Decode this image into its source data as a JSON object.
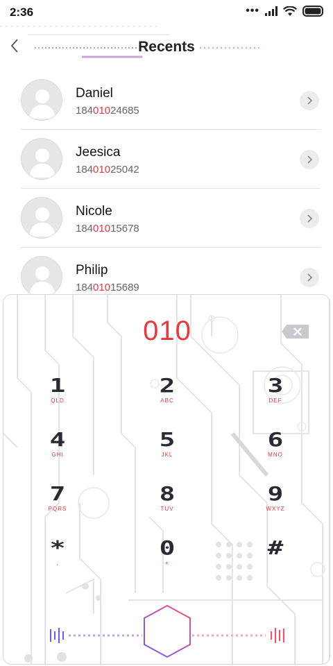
{
  "status": {
    "time": "2:36",
    "dots": "•••"
  },
  "header": {
    "title": "Recents"
  },
  "contacts": [
    {
      "name": "Daniel",
      "number_prefix": "184",
      "number_match": "010",
      "number_suffix": "24685"
    },
    {
      "name": "Jeesica",
      "number_prefix": "184",
      "number_match": "010",
      "number_suffix": "25042"
    },
    {
      "name": "Nicole",
      "number_prefix": "184",
      "number_match": "010",
      "number_suffix": "15678"
    },
    {
      "name": "Philip",
      "number_prefix": "184",
      "number_match": "010",
      "number_suffix": "15689"
    }
  ],
  "dialpad": {
    "dialed": "010",
    "keys": [
      {
        "digit": "1",
        "letters": "QLD"
      },
      {
        "digit": "2",
        "letters": "ABC"
      },
      {
        "digit": "3",
        "letters": "DEF"
      },
      {
        "digit": "4",
        "letters": "GHI"
      },
      {
        "digit": "5",
        "letters": "JKL"
      },
      {
        "digit": "6",
        "letters": "MNO"
      },
      {
        "digit": "7",
        "letters": "PQRS"
      },
      {
        "digit": "8",
        "letters": "TUV"
      },
      {
        "digit": "9",
        "letters": "WXYZ"
      },
      {
        "digit": "*",
        "letters": ","
      },
      {
        "digit": "0",
        "letters": "+"
      },
      {
        "digit": "#",
        "letters": ""
      }
    ]
  },
  "colors": {
    "accent": "#e8373e",
    "text": "#222222",
    "muted": "#666666",
    "voice_gradient_start": "#6a5cff",
    "voice_gradient_end": "#ff4d6d"
  }
}
